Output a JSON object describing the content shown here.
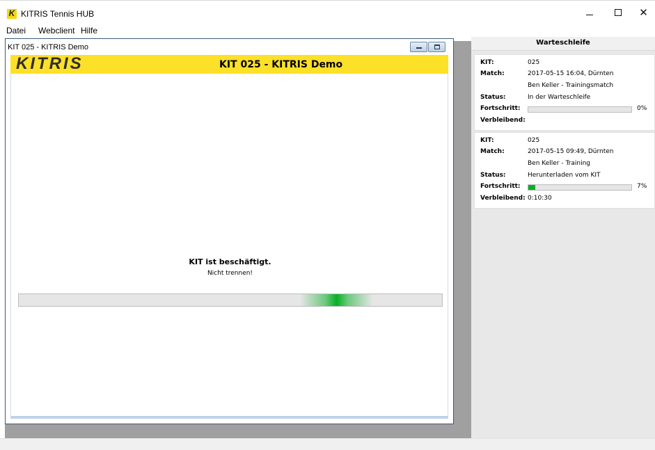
{
  "window": {
    "title": "KITRIS Tennis HUB",
    "logo_letter": "K",
    "minimize_glyph": "—",
    "maximize_glyph": "☐",
    "close_glyph": "✕"
  },
  "menu": [
    {
      "label": "Datei"
    },
    {
      "label": "Webclient"
    },
    {
      "label": "Hilfe"
    }
  ],
  "child_window": {
    "title": "KIT 025 - KITRIS Demo",
    "brand": "KITRIS",
    "banner_title": "KIT 025 - KITRIS Demo",
    "busy_title": "KIT ist beschäftigt.",
    "busy_subtitle": "Nicht trennen!",
    "busy_indicator_position": 0.75
  },
  "queue": {
    "header": "Warteschleife",
    "labels": {
      "kit": "KIT:",
      "match": "Match:",
      "status": "Status:",
      "progress": "Fortschritt:",
      "remaining": "Verbleibend:"
    },
    "jobs": [
      {
        "kit": "025",
        "match_line1": "2017-05-15 16:04, Dürnten",
        "match_line2": "Ben Keller - Trainingsmatch",
        "status": "In der Warteschleife",
        "progress_percent": 0,
        "progress_label": "0%",
        "remaining": ""
      },
      {
        "kit": "025",
        "match_line1": "2017-05-15 09:49, Dürnten",
        "match_line2": "Ben Keller - Training",
        "status": "Herunterladen vom KIT",
        "progress_percent": 7,
        "progress_label": "7%",
        "remaining": "0:10:30"
      }
    ]
  },
  "colors": {
    "brand_yellow": "#fde028",
    "progress_green": "#06b025",
    "mdi_background": "#a0a0a0"
  },
  "icons": {
    "app": "kitris-logo-icon",
    "child_minimize": "minimize-icon",
    "child_maximize": "maximize-icon"
  }
}
